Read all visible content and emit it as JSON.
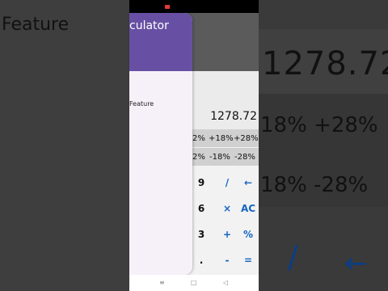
{
  "background": {
    "left_text": "Feature",
    "right_display": "1278.72",
    "right_pct_row1": "18%  +28%",
    "right_pct_row2": "18%  -28%",
    "right_key1": "/",
    "right_key2": "←"
  },
  "drawer": {
    "title": "culator",
    "item": "Feature"
  },
  "calculator": {
    "display": "1278.72",
    "pct_row1": [
      "2%",
      "+18%",
      "+28%"
    ],
    "pct_row2": [
      "2%",
      "-18%",
      "-28%"
    ],
    "keys": [
      [
        "9",
        "/",
        "←"
      ],
      [
        "6",
        "×",
        "AC"
      ],
      [
        "3",
        "+",
        "%"
      ],
      [
        ".",
        "-",
        "="
      ]
    ]
  },
  "navbar": {
    "icons": [
      "menu-icon",
      "home-square-icon",
      "back-triangle-icon"
    ],
    "glyphs": [
      "≡",
      "□",
      "◁"
    ]
  },
  "colors": {
    "drawer_header": "#6750a4",
    "drawer_bg": "#f6f1f9",
    "operator_blue": "#1565c0",
    "status_red": "#e53935"
  }
}
